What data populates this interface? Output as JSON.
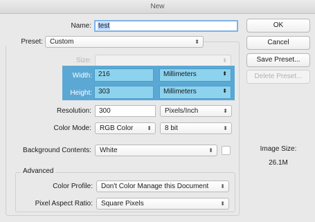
{
  "window": {
    "title": "New"
  },
  "name": {
    "label": "Name:",
    "value": "test"
  },
  "preset": {
    "label": "Preset:",
    "value": "Custom"
  },
  "size": {
    "label": "Size:",
    "value": ""
  },
  "width": {
    "label": "Width:",
    "value": "216",
    "unit": "Millimeters"
  },
  "height": {
    "label": "Height:",
    "value": "303",
    "unit": "Millimeters"
  },
  "resolution": {
    "label": "Resolution:",
    "value": "300",
    "unit": "Pixels/Inch"
  },
  "color_mode": {
    "label": "Color Mode:",
    "value": "RGB Color",
    "depth": "8 bit"
  },
  "background": {
    "label": "Background Contents:",
    "value": "White"
  },
  "advanced": {
    "title": "Advanced",
    "color_profile": {
      "label": "Color Profile:",
      "value": "Don't Color Manage this Document"
    },
    "pixel_aspect": {
      "label": "Pixel Aspect Ratio:",
      "value": "Square Pixels"
    }
  },
  "buttons": {
    "ok": "OK",
    "cancel": "Cancel",
    "save_preset": "Save Preset...",
    "delete_preset": "Delete Preset..."
  },
  "image_size": {
    "label": "Image Size:",
    "value": "26.1M"
  },
  "colors": {
    "highlight": "#5ba8d4",
    "highlight_field": "#8dd3ee",
    "focus": "#7fb2e6"
  }
}
